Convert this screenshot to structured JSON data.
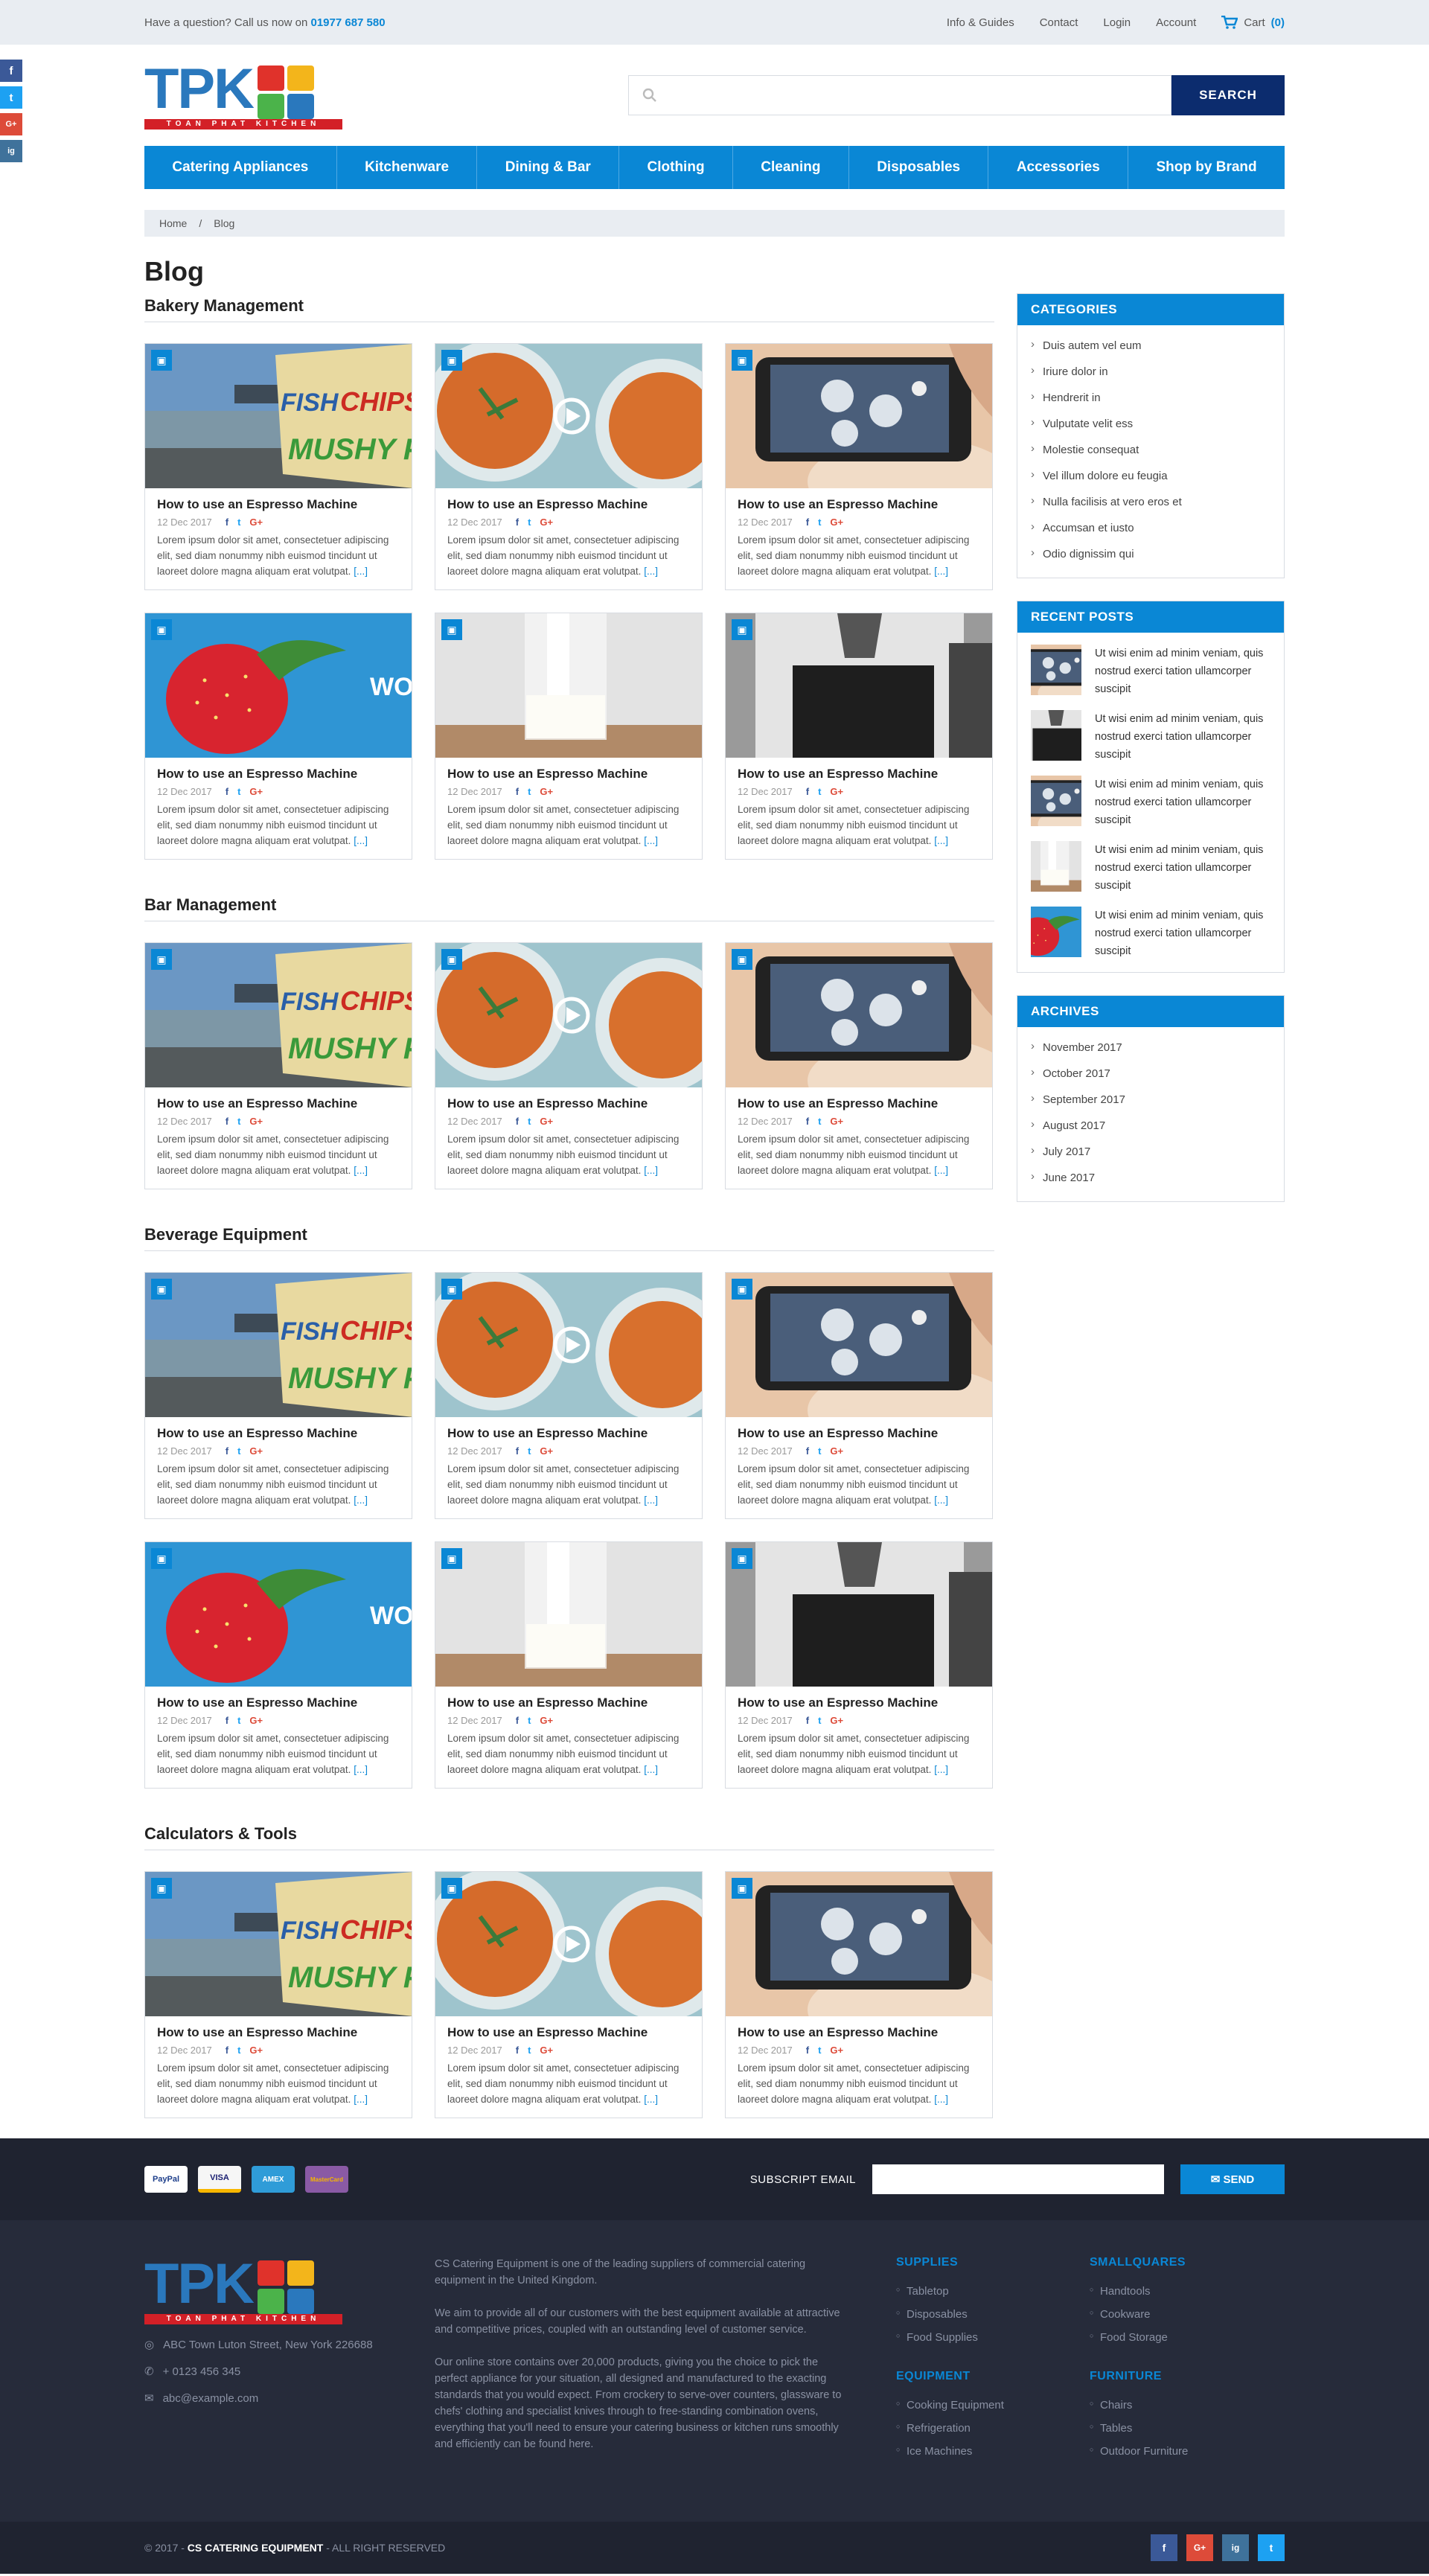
{
  "topbar": {
    "question": "Have a question? Call us now on",
    "phone": "01977 687 580",
    "links": [
      "Info & Guides",
      "Contact",
      "Login",
      "Account"
    ],
    "cart_label": "Cart",
    "cart_count": "(0)"
  },
  "social_side": [
    "f",
    "t",
    "G+",
    "ig"
  ],
  "logo": {
    "text": "TPK",
    "tagline": "TOAN PHAT KITCHEN"
  },
  "search": {
    "placeholder": "",
    "button": "SEARCH"
  },
  "nav": [
    "Catering Appliances",
    "Kitchenware",
    "Dining & Bar",
    "Clothing",
    "Cleaning",
    "Disposables",
    "Accessories",
    "Shop by Brand"
  ],
  "breadcrumb": {
    "home": "Home",
    "sep": "/",
    "current": "Blog"
  },
  "page_title": "Blog",
  "post": {
    "title": "How to use an Espresso Machine",
    "date": "12 Dec 2017",
    "excerpt": "Lorem ipsum dolor sit amet, consectetuer adipiscing elit, sed diam nonummy nibh euismod tincidunt ut laoreet dolore magna aliquam erat volutpat.",
    "more": "[...]",
    "share": [
      "f",
      "t",
      "G+"
    ]
  },
  "sections": [
    {
      "title": "Bakery Management",
      "images": [
        "fish",
        "soup",
        "phone",
        "straw",
        "milk",
        "chef"
      ]
    },
    {
      "title": "Bar Management",
      "images": [
        "fish",
        "soup",
        "phone"
      ]
    },
    {
      "title": "Beverage Equipment",
      "images": [
        "fish",
        "soup",
        "phone",
        "straw",
        "milk",
        "chef"
      ]
    },
    {
      "title": "Calculators & Tools",
      "images": [
        "fish",
        "soup",
        "phone"
      ]
    }
  ],
  "sidebar": {
    "categories_title": "CATEGORIES",
    "categories": [
      "Duis autem vel eum",
      "Iriure dolor in",
      "Hendrerit in",
      "Vulputate velit ess",
      "Molestie consequat",
      "Vel illum dolore eu feugia",
      "Nulla facilisis at vero eros et",
      "Accumsan et iusto",
      "Odio dignissim qui"
    ],
    "recent_title": "RECENT POSTS",
    "recent_text": "Ut wisi enim ad minim veniam, quis nostrud exerci tation ullamcorper suscipit",
    "recent_images": [
      "phone",
      "chef",
      "phone",
      "milk",
      "straw"
    ],
    "archives_title": "ARCHIVES",
    "archives": [
      "November 2017",
      "October 2017",
      "September 2017",
      "August 2017",
      "July 2017",
      "June 2017"
    ]
  },
  "footer": {
    "cards": [
      "PayPal",
      "VISA",
      "AMEX",
      "MasterCard"
    ],
    "subscribe_label": "SUBSCRIPT EMAIL",
    "send": "SEND",
    "address": "ABC Town Luton Street, New York 226688",
    "phone": "+ 0123 456 345",
    "email": "abc@example.com",
    "about": [
      "CS Catering Equipment is one of the leading suppliers of commercial catering equipment in the United Kingdom.",
      "We aim to provide all of our customers with the best equipment available at attractive and competitive prices, coupled with an outstanding level of customer service.",
      "Our online store contains over 20,000 products, giving you the choice to pick the perfect appliance for your situation, all designed and manufactured to the exacting standards that you would expect. From crockery to serve-over counters, glassware to chefs' clothing and specialist knives through to free-standing combination ovens, everything that you'll need to ensure your catering business or kitchen runs smoothly and efficiently can be found here."
    ],
    "supplies_title": "SUPPLIES",
    "supplies": [
      "Tabletop",
      "Disposables",
      "Food Supplies"
    ],
    "equipment_title": "EQUIPMENT",
    "equipment": [
      "Cooking Equipment",
      "Refrigeration",
      "Ice Machines"
    ],
    "smallwares_title": "SMALLQUARES",
    "smallwares": [
      "Handtools",
      "Cookware",
      "Food Storage"
    ],
    "furniture_title": "FURNITURE",
    "furniture": [
      "Chairs",
      "Tables",
      "Outdoor Furniture"
    ],
    "copyright_pre": "© 2017 -",
    "copyright_brand": "CS CATERING EQUIPMENT",
    "copyright_post": "- ALL RIGHT RESERVED",
    "social": [
      "f",
      "G+",
      "ig",
      "t"
    ]
  },
  "colors": {
    "primary": "#0a87d5",
    "navy": "#0c2c6e",
    "footer": "#262b3a"
  }
}
